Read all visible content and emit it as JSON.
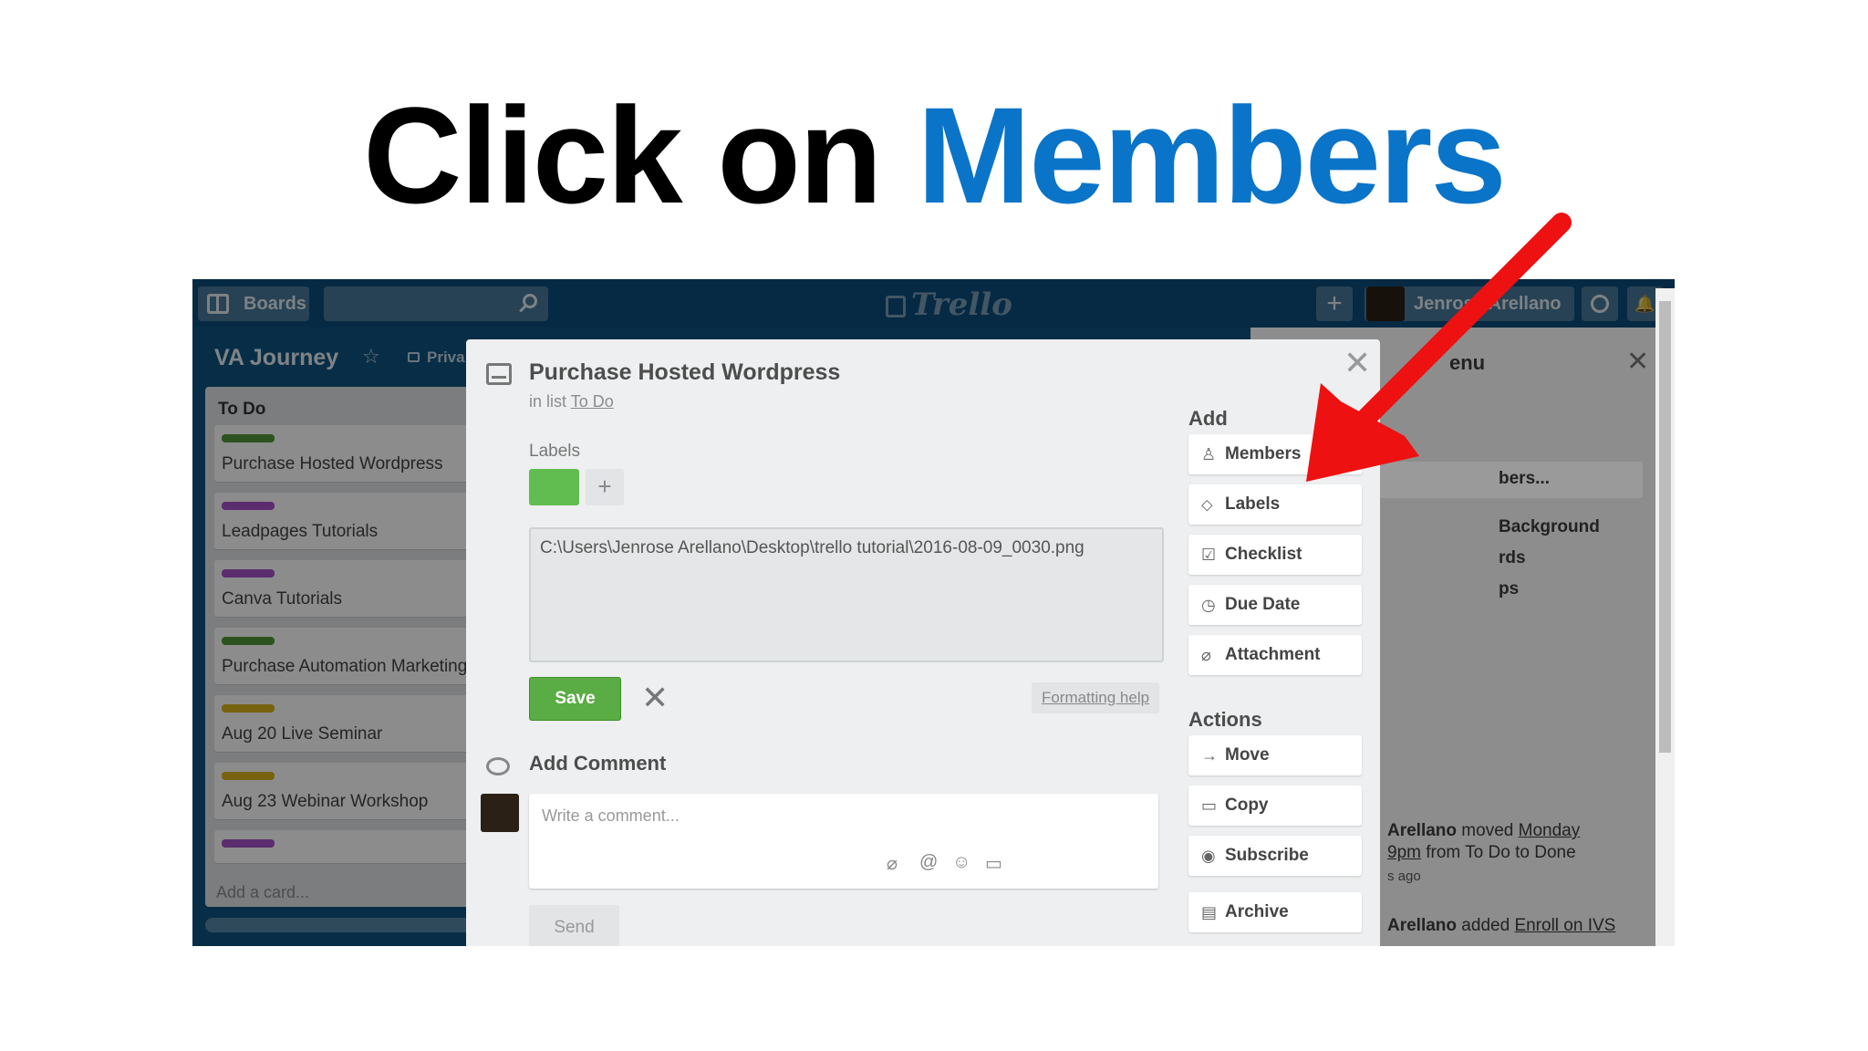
{
  "headline": {
    "part1": "Click on ",
    "part2": "Members"
  },
  "topbar": {
    "boards_label": "Boards",
    "logo_text": "Trello",
    "plus_label": "+",
    "user_name": "Jenrose Arellano",
    "bell_glyph": "🔔"
  },
  "board": {
    "title": "VA Journey",
    "privacy": "Priva",
    "list": {
      "title": "To Do",
      "cards": [
        {
          "label_color": "#519839",
          "text": "Purchase Hosted Wordpress"
        },
        {
          "label_color": "#a651c9",
          "text": "Leadpages Tutorials"
        },
        {
          "label_color": "#a651c9",
          "text": "Canva Tutorials"
        },
        {
          "label_color": "#519839",
          "text": "Purchase Automation Marketing"
        },
        {
          "label_color": "#d9b51c",
          "text": "Aug 20 Live Seminar"
        },
        {
          "label_color": "#d9b51c",
          "text": "Aug 23 Webinar Workshop"
        },
        {
          "label_color": "#a651c9",
          "text": ""
        }
      ],
      "add_card": "Add a card..."
    }
  },
  "menu": {
    "title": "enu",
    "members_row": "bers...",
    "links": [
      "Background",
      "rds",
      "ps"
    ],
    "activity": [
      {
        "actor": "Arellano",
        "verb": " moved ",
        "link": "Monday",
        "rest": ""
      },
      {
        "actor": "",
        "verb": "",
        "link": "9pm",
        "rest": " from To Do to Done"
      },
      {
        "actor": "",
        "verb": "s ago",
        "link": "",
        "rest": ""
      },
      {
        "actor": "Arellano",
        "verb": " added ",
        "link": "Enroll on IVS",
        "rest": ""
      }
    ]
  },
  "modal": {
    "title": "Purchase Hosted Wordpress",
    "in_list_prefix": "in list ",
    "in_list_name": "To Do",
    "labels_heading": "Labels",
    "label_color": "#61bd4f",
    "label_add": "+",
    "description_value": "C:\\Users\\Jenrose Arellano\\Desktop\\trello tutorial\\2016-08-09_0030.png",
    "save_label": "Save",
    "formatting_help": "Formatting help",
    "comment_heading": "Add Comment",
    "comment_placeholder": "Write a comment...",
    "send_label": "Send",
    "add_heading": "Add",
    "add_buttons": [
      "Members",
      "Labels",
      "Checklist",
      "Due Date",
      "Attachment"
    ],
    "actions_heading": "Actions",
    "action_buttons": [
      "Move",
      "Copy",
      "Subscribe",
      "Archive"
    ]
  },
  "colors": {
    "headline_blue": "#0a74c9",
    "arrow_red": "#ee1111",
    "board_blue": "#0f5582"
  }
}
